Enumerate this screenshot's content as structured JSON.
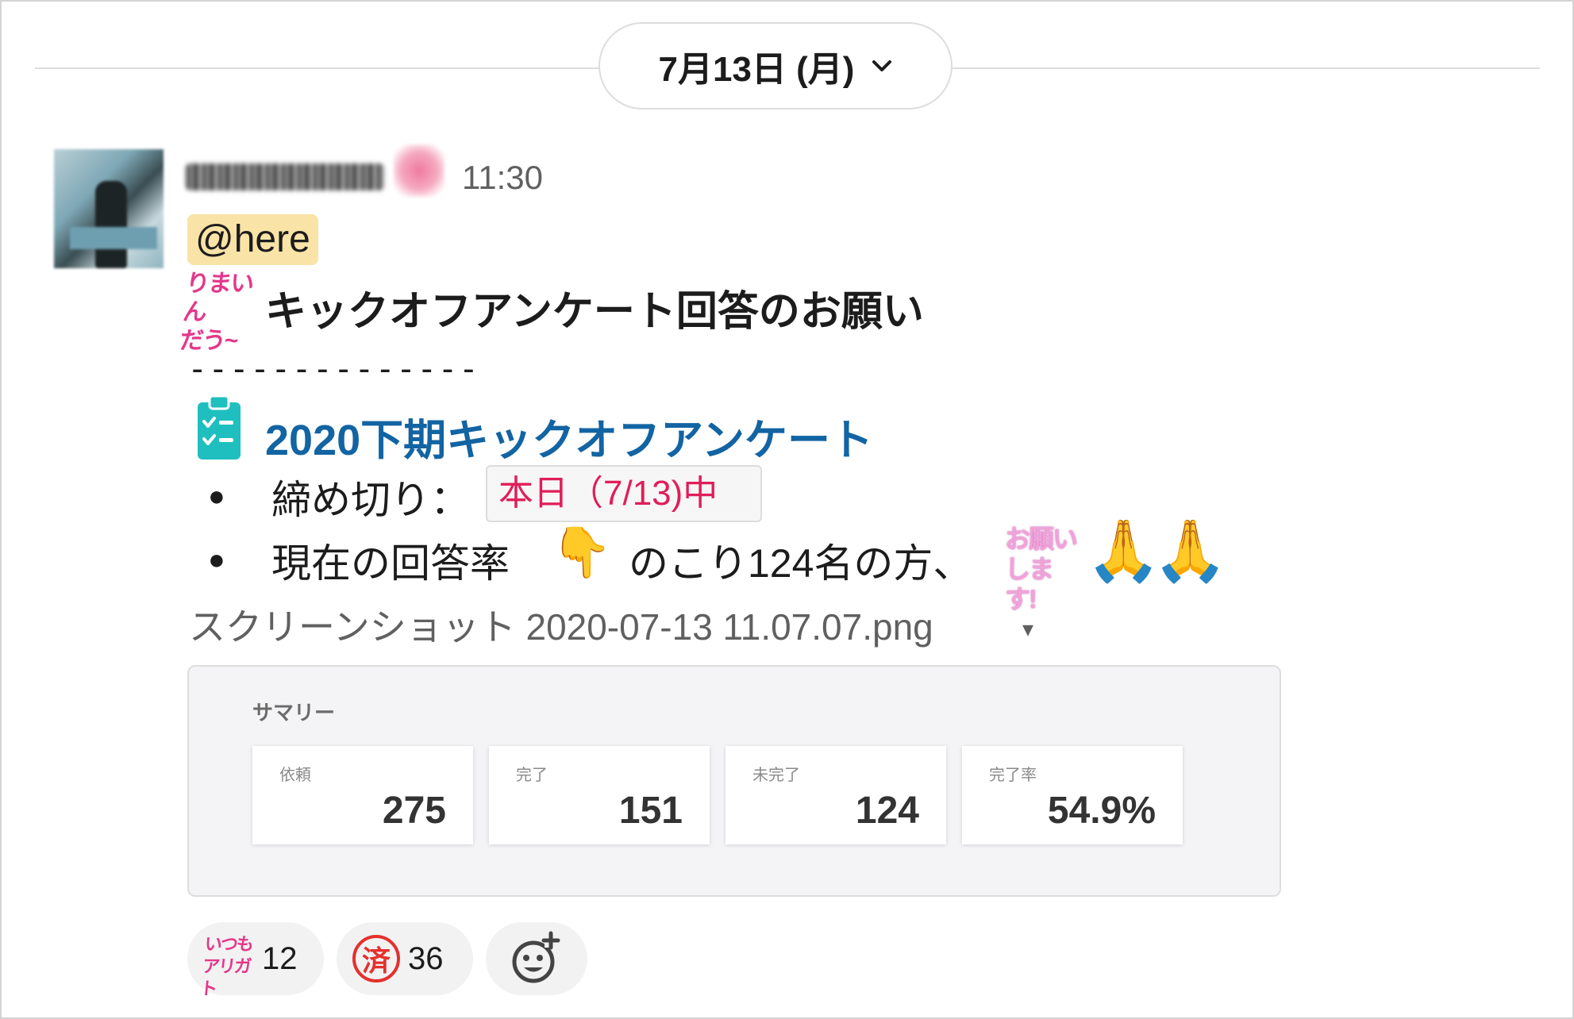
{
  "date_divider": {
    "label": "7月13日 (月)",
    "chevron": "chevron-down-icon"
  },
  "message": {
    "timestamp": "11:30",
    "mention": "@here",
    "kickoff_emoji_text": [
      "りまいん",
      "だう~"
    ],
    "headline": "キックオフアンケート回答のお願い",
    "dashes": "--------------",
    "survey_link": "2020下期キックオフアンケート",
    "bullets": {
      "deadline_label": "締め切り：",
      "deadline_value": "本日（7/13)中",
      "rate_label": "現在の回答率",
      "remaining": "のこり124名の方、",
      "onegai_emoji_text": [
        "お願い",
        "します!"
      ]
    },
    "emoji_glyphs": {
      "point_down": "👇",
      "pray": "🙏"
    }
  },
  "attachment": {
    "file_name": "スクリーンショット 2020-07-13 11.07.07.png",
    "caret": "▾",
    "preview": {
      "title": "サマリー",
      "cards": [
        {
          "label": "依頼",
          "value": "275"
        },
        {
          "label": "完了",
          "value": "151"
        },
        {
          "label": "未完了",
          "value": "124"
        },
        {
          "label": "完了率",
          "value": "54.9%"
        }
      ]
    }
  },
  "reactions": [
    {
      "emoji": "itsumo-arigato-icon",
      "emoji_text": [
        "いつも",
        "アリガト"
      ],
      "count": "12"
    },
    {
      "emoji": "sumi-stamp-icon",
      "emoji_text": "済",
      "count": "36"
    }
  ],
  "colors": {
    "link": "#1264a3",
    "mention_bg": "#f9e3a6",
    "code_text": "#e01e5a",
    "timestamp": "#616061",
    "reaction_bg": "#f2f2f2"
  }
}
